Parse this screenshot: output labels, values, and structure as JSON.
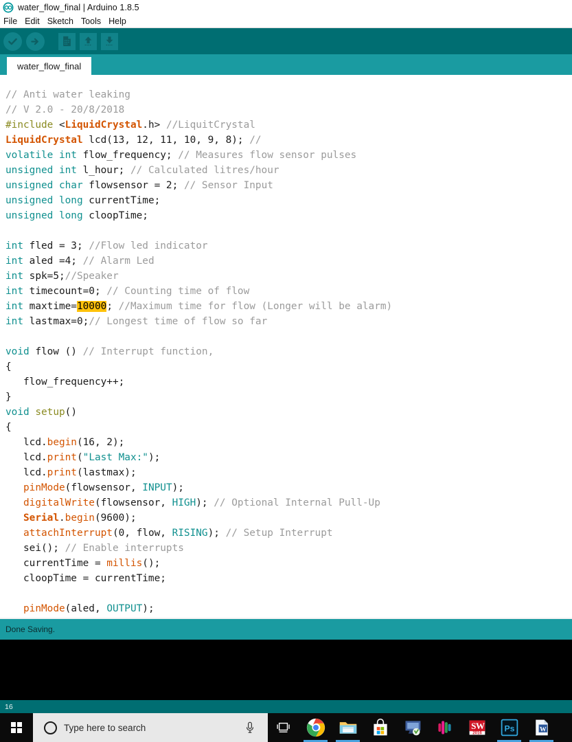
{
  "window": {
    "title": "water_flow_final | Arduino 1.8.5",
    "logo_icon": "arduino-infinity-icon"
  },
  "menubar": {
    "items": [
      {
        "label": "File"
      },
      {
        "label": "Edit"
      },
      {
        "label": "Sketch"
      },
      {
        "label": "Tools"
      },
      {
        "label": "Help"
      }
    ]
  },
  "toolbar": {
    "buttons": [
      {
        "name": "verify",
        "icon": "check-icon",
        "tooltip": "Verify"
      },
      {
        "name": "upload",
        "icon": "arrow-right-icon",
        "tooltip": "Upload"
      },
      {
        "name": "new",
        "icon": "new-file-icon",
        "tooltip": "New"
      },
      {
        "name": "open",
        "icon": "arrow-up-icon",
        "tooltip": "Open"
      },
      {
        "name": "save",
        "icon": "arrow-down-icon",
        "tooltip": "Save"
      }
    ]
  },
  "tabs": {
    "active": "water_flow_final"
  },
  "editor": {
    "font_size": 14,
    "highlight_color": "#FFC20A",
    "lines": [
      [
        {
          "t": "// Anti water leaking",
          "c": "comment"
        }
      ],
      [
        {
          "t": "// V 2.0 - 20/8/2018",
          "c": "comment"
        }
      ],
      [
        {
          "t": "#include ",
          "c": "pre"
        },
        {
          "t": "<",
          "c": "plain"
        },
        {
          "t": "LiquidCrystal",
          "c": "kw2"
        },
        {
          "t": ".h> ",
          "c": "plain"
        },
        {
          "t": "//LiquitCrystal",
          "c": "comment"
        }
      ],
      [
        {
          "t": "LiquidCrystal",
          "c": "kw2"
        },
        {
          "t": " lcd(13, 12, 11, 10, 9, 8); ",
          "c": "plain"
        },
        {
          "t": "//",
          "c": "comment"
        }
      ],
      [
        {
          "t": "volatile int",
          "c": "kw"
        },
        {
          "t": " flow_frequency; ",
          "c": "plain"
        },
        {
          "t": "// Measures flow sensor pulses",
          "c": "comment"
        }
      ],
      [
        {
          "t": "unsigned int",
          "c": "kw"
        },
        {
          "t": " l_hour; ",
          "c": "plain"
        },
        {
          "t": "// Calculated litres/hour",
          "c": "comment"
        }
      ],
      [
        {
          "t": "unsigned char",
          "c": "kw"
        },
        {
          "t": " flowsensor = 2; ",
          "c": "plain"
        },
        {
          "t": "// Sensor Input",
          "c": "comment"
        }
      ],
      [
        {
          "t": "unsigned long",
          "c": "kw"
        },
        {
          "t": " currentTime;",
          "c": "plain"
        }
      ],
      [
        {
          "t": "unsigned long",
          "c": "kw"
        },
        {
          "t": " cloopTime;",
          "c": "plain"
        }
      ],
      [
        {
          "t": "",
          "c": "plain"
        }
      ],
      [
        {
          "t": "int",
          "c": "kw"
        },
        {
          "t": " fled = 3; ",
          "c": "plain"
        },
        {
          "t": "//Flow led indicator",
          "c": "comment"
        }
      ],
      [
        {
          "t": "int",
          "c": "kw"
        },
        {
          "t": " aled =4; ",
          "c": "plain"
        },
        {
          "t": "// Alarm Led",
          "c": "comment"
        }
      ],
      [
        {
          "t": "int",
          "c": "kw"
        },
        {
          "t": " spk=5;",
          "c": "plain"
        },
        {
          "t": "//Speaker",
          "c": "comment"
        }
      ],
      [
        {
          "t": "int",
          "c": "kw"
        },
        {
          "t": " timecount=0; ",
          "c": "plain"
        },
        {
          "t": "// Counting time of flow",
          "c": "comment"
        }
      ],
      [
        {
          "t": "int",
          "c": "kw"
        },
        {
          "t": " maxtime=",
          "c": "plain"
        },
        {
          "t": "10000",
          "c": "hl"
        },
        {
          "t": "; ",
          "c": "plain"
        },
        {
          "t": "//Maximum time for flow (Longer will be alarm)",
          "c": "comment"
        }
      ],
      [
        {
          "t": "int",
          "c": "kw"
        },
        {
          "t": " lastmax=0;",
          "c": "plain"
        },
        {
          "t": "// Longest time of flow so far",
          "c": "comment"
        }
      ],
      [
        {
          "t": "",
          "c": "plain"
        }
      ],
      [
        {
          "t": "void",
          "c": "kw"
        },
        {
          "t": " flow () ",
          "c": "plain"
        },
        {
          "t": "// Interrupt function,",
          "c": "comment"
        }
      ],
      [
        {
          "t": "{",
          "c": "plain"
        }
      ],
      [
        {
          "t": "   flow_frequency++;",
          "c": "plain"
        }
      ],
      [
        {
          "t": "}",
          "c": "plain"
        }
      ],
      [
        {
          "t": "void ",
          "c": "kw"
        },
        {
          "t": "setup",
          "c": "fn2"
        },
        {
          "t": "()",
          "c": "plain"
        }
      ],
      [
        {
          "t": "{",
          "c": "plain"
        }
      ],
      [
        {
          "t": "   lcd.",
          "c": "plain"
        },
        {
          "t": "begin",
          "c": "fn"
        },
        {
          "t": "(16, 2);",
          "c": "plain"
        }
      ],
      [
        {
          "t": "   lcd.",
          "c": "plain"
        },
        {
          "t": "print",
          "c": "fn"
        },
        {
          "t": "(",
          "c": "plain"
        },
        {
          "t": "\"Last Max:\"",
          "c": "str"
        },
        {
          "t": ");",
          "c": "plain"
        }
      ],
      [
        {
          "t": "   lcd.",
          "c": "plain"
        },
        {
          "t": "print",
          "c": "fn"
        },
        {
          "t": "(lastmax);",
          "c": "plain"
        }
      ],
      [
        {
          "t": "   ",
          "c": "plain"
        },
        {
          "t": "pinMode",
          "c": "fn"
        },
        {
          "t": "(flowsensor, ",
          "c": "plain"
        },
        {
          "t": "INPUT",
          "c": "lit"
        },
        {
          "t": ");",
          "c": "plain"
        }
      ],
      [
        {
          "t": "   ",
          "c": "plain"
        },
        {
          "t": "digitalWrite",
          "c": "fn"
        },
        {
          "t": "(flowsensor, ",
          "c": "plain"
        },
        {
          "t": "HIGH",
          "c": "lit"
        },
        {
          "t": "); ",
          "c": "plain"
        },
        {
          "t": "// Optional Internal Pull-Up",
          "c": "comment"
        }
      ],
      [
        {
          "t": "   ",
          "c": "plain"
        },
        {
          "t": "Serial",
          "c": "kw2"
        },
        {
          "t": ".",
          "c": "plain"
        },
        {
          "t": "begin",
          "c": "fn"
        },
        {
          "t": "(9600);",
          "c": "plain"
        }
      ],
      [
        {
          "t": "   ",
          "c": "plain"
        },
        {
          "t": "attachInterrupt",
          "c": "fn"
        },
        {
          "t": "(0, flow, ",
          "c": "plain"
        },
        {
          "t": "RISING",
          "c": "lit"
        },
        {
          "t": "); ",
          "c": "plain"
        },
        {
          "t": "// Setup Interrupt",
          "c": "comment"
        }
      ],
      [
        {
          "t": "   sei(); ",
          "c": "plain"
        },
        {
          "t": "// Enable interrupts",
          "c": "comment"
        }
      ],
      [
        {
          "t": "   currentTime = ",
          "c": "plain"
        },
        {
          "t": "millis",
          "c": "fn"
        },
        {
          "t": "();",
          "c": "plain"
        }
      ],
      [
        {
          "t": "   cloopTime = currentTime;",
          "c": "plain"
        }
      ],
      [
        {
          "t": "",
          "c": "plain"
        }
      ],
      [
        {
          "t": "   ",
          "c": "plain"
        },
        {
          "t": "pinMode",
          "c": "fn"
        },
        {
          "t": "(aled, ",
          "c": "plain"
        },
        {
          "t": "OUTPUT",
          "c": "lit"
        },
        {
          "t": ");",
          "c": "plain"
        }
      ]
    ]
  },
  "status": {
    "message": "Done Saving.",
    "line_number": "16"
  },
  "taskbar": {
    "start_icon": "windows-logo-icon",
    "search_placeholder": "Type here to search",
    "cortana_icon": "cortana-circle-icon",
    "mic_icon": "microphone-icon",
    "taskview_icon": "task-view-icon",
    "apps": [
      {
        "name": "chrome",
        "label": "Google Chrome",
        "running": true
      },
      {
        "name": "file-explorer",
        "label": "File Explorer",
        "running": true
      },
      {
        "name": "microsoft-store",
        "label": "Microsoft Store",
        "running": false
      },
      {
        "name": "remote-display",
        "label": "Remote Display",
        "running": false
      },
      {
        "name": "color-bars-app",
        "label": "Media App",
        "running": false
      },
      {
        "name": "solidworks",
        "label": "SolidWorks 2016",
        "running": true
      },
      {
        "name": "photoshop",
        "label": "Adobe Photoshop",
        "running": true
      },
      {
        "name": "word",
        "label": "Microsoft Word",
        "running": true
      }
    ]
  }
}
